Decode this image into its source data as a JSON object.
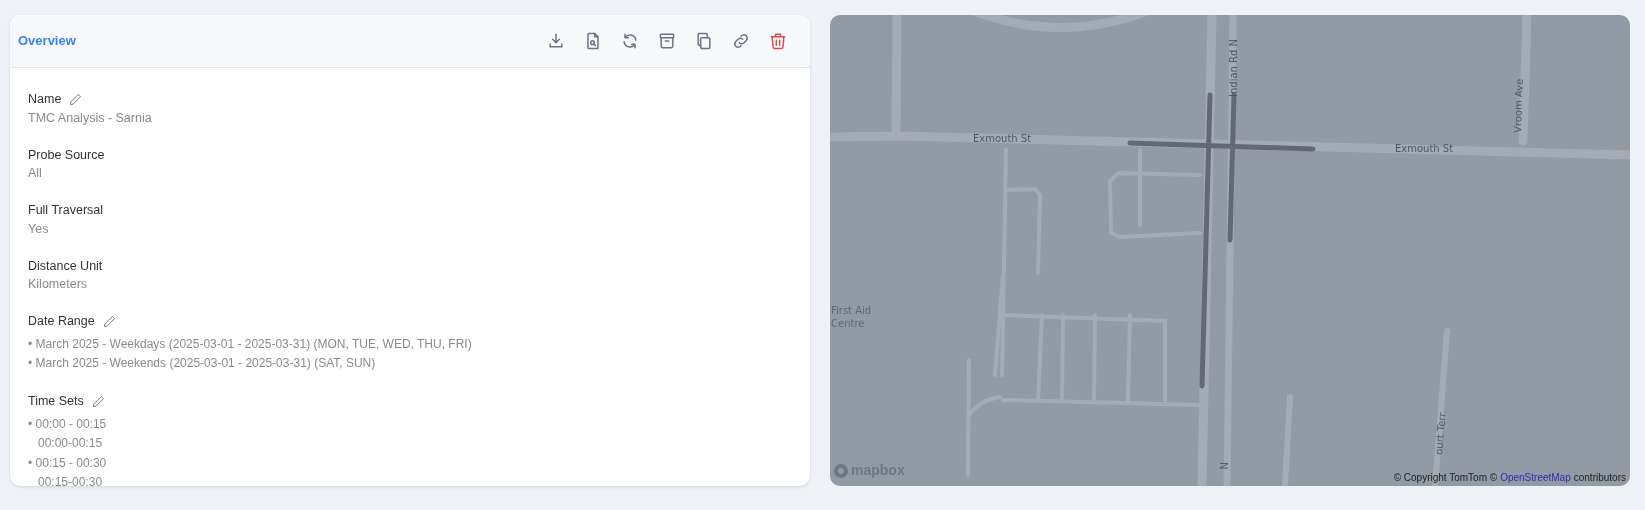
{
  "panel": {
    "title": "Overview",
    "toolbar": [
      {
        "kind": "download"
      },
      {
        "kind": "file-search"
      },
      {
        "kind": "refresh"
      },
      {
        "kind": "archive"
      },
      {
        "kind": "copy"
      },
      {
        "kind": "link"
      },
      {
        "kind": "delete"
      }
    ],
    "fields": [
      {
        "kind": "text",
        "label": "Name",
        "editable": true,
        "value": "TMC Analysis - Sarnia"
      },
      {
        "kind": "text",
        "label": "Probe Source",
        "editable": false,
        "value": "All"
      },
      {
        "kind": "text",
        "label": "Full Traversal",
        "editable": false,
        "value": "Yes"
      },
      {
        "kind": "text",
        "label": "Distance Unit",
        "editable": false,
        "value": "Kilometers"
      },
      {
        "kind": "list",
        "label": "Date Range",
        "editable": true,
        "items": [
          "• March 2025 - Weekdays (2025-03-01 - 2025-03-31) (MON, TUE, WED, THU, FRI)",
          "• March 2025 - Weekends (2025-03-01 - 2025-03-31) (SAT, SUN)"
        ]
      },
      {
        "kind": "timesets",
        "label": "Time Sets",
        "editable": true,
        "items": [
          {
            "range": "• 00:00 - 00:15",
            "detail": "00:00-00:15"
          },
          {
            "range": "• 00:15 - 00:30",
            "detail": "00:15-00:30"
          }
        ]
      }
    ]
  },
  "map": {
    "labels": [
      {
        "kind": "street",
        "text": "Exmouth St"
      },
      {
        "kind": "street",
        "text": "Exmouth St"
      },
      {
        "kind": "street",
        "text": "Indian Rd N"
      },
      {
        "kind": "street",
        "text": "Vroom Ave"
      },
      {
        "kind": "place",
        "text": "First Aid"
      },
      {
        "kind": "place",
        "text": "Centre"
      },
      {
        "kind": "street",
        "text": "ourt Terr"
      },
      {
        "kind": "street",
        "text": "N"
      }
    ],
    "logo": "mapbox",
    "attribution": {
      "prefix": "© Copyright TomTom ©",
      "link": "OpenStreetMap",
      "suffix": "contributors"
    }
  }
}
